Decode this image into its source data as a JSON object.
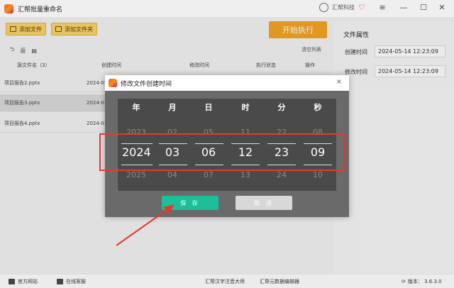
{
  "app": {
    "title": "汇帮批量重命名"
  },
  "titlebar": {
    "brand": "汇帮科技",
    "ctrl_menu": "≡",
    "ctrl_min": "—",
    "ctrl_max": "☐",
    "ctrl_close": "✕"
  },
  "toolbar": {
    "add_file": "添加文件",
    "add_folder": "添加文件夹",
    "start": "开始执行",
    "undo": "返",
    "clear_list": "清空列表"
  },
  "table": {
    "headers": [
      "源文件名（3）",
      "创建时间",
      "修改时间",
      "执行状态",
      "操作"
    ],
    "rows": [
      {
        "name": "项目报告2.pptx",
        "created": "2024-01"
      },
      {
        "name": "项目报告3.pptx",
        "created": "2024-01"
      },
      {
        "name": "项目报告4.pptx",
        "created": "2024-01"
      }
    ]
  },
  "side": {
    "title": "文件属性",
    "created_label": "创建时间",
    "created_value": "2024-05-14 12:23:09",
    "modified_label": "修改时间",
    "modified_value": "2024-05-14 12:23:09"
  },
  "statusbar": {
    "website": "官方网站",
    "support": "在线客服",
    "tool1": "汇帮汉字注音大师",
    "tool2": "汇帮元数据编辑器",
    "version": "版本： 3.6.3.0"
  },
  "dialog": {
    "title": "修改文件创建时间",
    "close": "×",
    "columns": [
      {
        "head": "年",
        "prev": "2023",
        "curr": "2024",
        "next": "2025"
      },
      {
        "head": "月",
        "prev": "02",
        "curr": "03",
        "next": "04"
      },
      {
        "head": "日",
        "prev": "05",
        "curr": "06",
        "next": "07"
      },
      {
        "head": "时",
        "prev": "11",
        "curr": "12",
        "next": "13"
      },
      {
        "head": "分",
        "prev": "22",
        "curr": "23",
        "next": "24"
      },
      {
        "head": "秒",
        "prev": "08",
        "curr": "09",
        "next": "10"
      }
    ],
    "save": "保 存",
    "cancel": "取 消"
  },
  "colors": {
    "highlight": "#e23b2f",
    "save": "#1dbf9a",
    "start": "#f6a523"
  }
}
